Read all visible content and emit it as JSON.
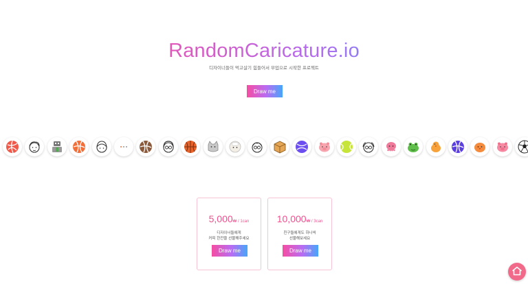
{
  "hero": {
    "title": "RandomCaricature.io",
    "subtitle": "디자이너들이 먹고살기 힘들어서 부업으로 시작한 프로젝트",
    "cta_label": "Draw me"
  },
  "icon_strip": [
    "red-volleyball-icon",
    "man-outline-face-icon",
    "robot-figure-icon",
    "orange-volleyball-icon",
    "man-face-outline-icon",
    "speech-dots-icon",
    "brown-volleyball-icon",
    "woman-glasses-face-icon",
    "basketball-icon",
    "gray-cat-icon",
    "sheep-icon",
    "old-man-glasses-icon",
    "cardboard-box-icon",
    "purple-ball-icon",
    "pink-pig-icon",
    "tennis-ball-icon",
    "grandpa-glasses-icon",
    "pink-octopus-icon",
    "green-frog-icon",
    "orange-chick-icon",
    "purple-volleyball-icon",
    "orange-bird-icon",
    "pink-pig-face-icon",
    "soccer-ball-icon"
  ],
  "pricing": [
    {
      "amount": "5,000",
      "unit": "₩ / 1can",
      "desc_line1": "디자이너들에게",
      "desc_line2": "커피 한잔을 선물해주세요",
      "button": "Draw me"
    },
    {
      "amount": "10,000",
      "unit": "₩ / 3can",
      "desc_line1": "친구들에게도 하나씩",
      "desc_line2": "선물해보세요",
      "button": "Draw me"
    }
  ],
  "fab": {
    "icon": "home-icon"
  },
  "colors": {
    "pink": "#f54ea2",
    "purple": "#b76df3",
    "blue": "#46a6f8",
    "card_border": "#f7c3d3",
    "price": "#f0508f",
    "fab": "#f26a8a"
  }
}
